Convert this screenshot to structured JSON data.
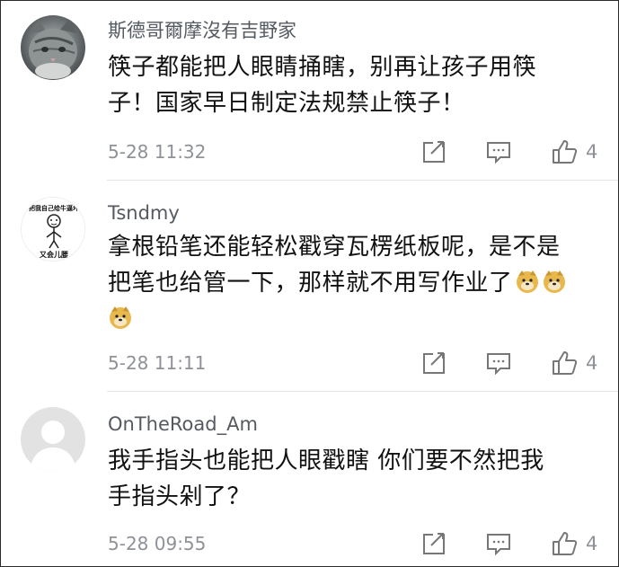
{
  "comments": [
    {
      "username": "斯德哥爾摩沒有吉野家",
      "line1": "筷子都能把人眼睛捅瞎，别再让孩子用筷",
      "line2": "子！国家早日制定法规禁止筷子！",
      "timestamp": "5-28 11:32",
      "likes": "4",
      "avatar_icon": "cat-avatar-icon"
    },
    {
      "username": "Tsndmy",
      "line1": "拿根铅笔还能轻松戳穿瓦楞纸板呢，是不是",
      "line2": "把笔也给管一下，那样就不用写作业了",
      "emoji": "doge-emoji-icon",
      "timestamp": "5-28 11:11",
      "likes": "4",
      "avatar_top_text": "把我自己给牛逼坏",
      "avatar_bottom_text": "又会儿腰"
    },
    {
      "username": "OnTheRoad_Am",
      "line1": "我手指头也能把人眼戳瞎 你们要不然把我",
      "line2": "手指头剁了？",
      "timestamp": "5-28 09:55",
      "likes": "4",
      "avatar_icon": "default-user-avatar-icon"
    }
  ],
  "colors": {
    "username": "#555a60",
    "body": "#111111",
    "meta": "#8e9196",
    "divider": "#e4e4e4"
  },
  "action_icons": [
    "share-icon",
    "comment-icon",
    "thumbs-up-icon"
  ]
}
